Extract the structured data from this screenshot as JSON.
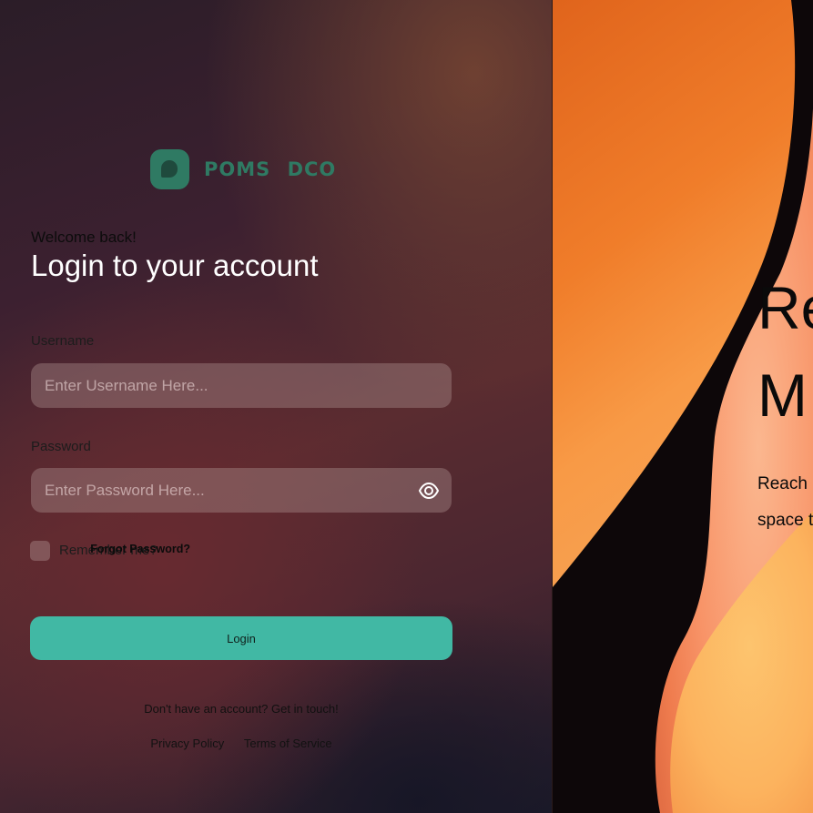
{
  "brand": {
    "name": "POMS DCO",
    "accent_color": "#2f7a63"
  },
  "login": {
    "welcome": "Welcome back!",
    "heading": "Login to your account",
    "username_label": "Username",
    "username_placeholder": "Enter Username Here...",
    "username_value": "",
    "password_label": "Password",
    "password_placeholder": "Enter Password Here...",
    "password_value": "",
    "password_toggle_icon": "eye-icon",
    "remember_label": "Remember me?",
    "remember_checked": false,
    "forgot_label": "Forgot Password?",
    "submit_label": "Login",
    "submit_color": "#41b8a4"
  },
  "footer": {
    "signup_prompt": "Don't have an account?",
    "signup_link": "Get in touch!",
    "links": [
      "Privacy Policy",
      "Terms of Service"
    ]
  },
  "hero": {
    "title_lines": [
      "Re",
      "M"
    ],
    "text_lines": [
      "Reach u",
      "space t"
    ]
  }
}
